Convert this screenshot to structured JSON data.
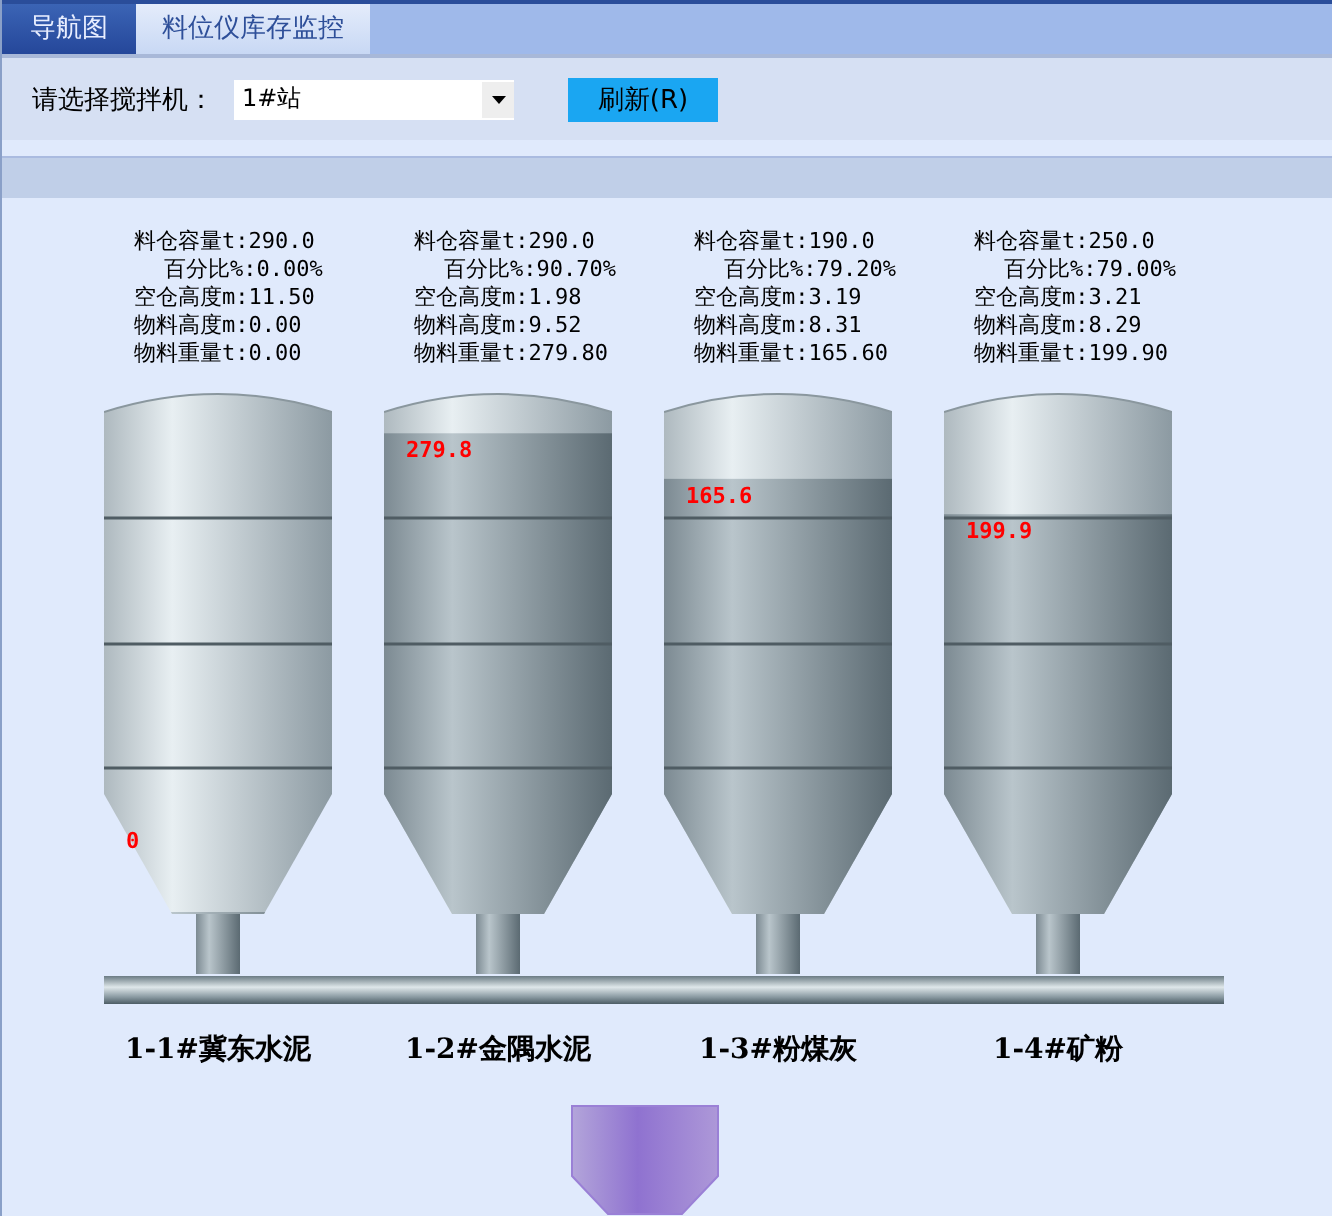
{
  "tabs": [
    {
      "label": "导航图",
      "selected": false
    },
    {
      "label": "料位仪库存监控",
      "selected": true
    }
  ],
  "toolbar": {
    "label": "请选择搅拌机：",
    "select_value": "1#站",
    "refresh_button": "刷新(R)"
  },
  "silos": [
    {
      "capacity": "料仓容量t:290.0",
      "percent": "百分比%:0.00%",
      "empty_height": "空仓高度m:11.50",
      "material_height": "物料高度m:0.00",
      "weight": "物料重量t:0.00",
      "level": 0,
      "fill_label": "0",
      "name": "1-1#冀东水泥"
    },
    {
      "capacity": "料仓容量t:290.0",
      "percent": "百分比%:90.70%",
      "empty_height": "空仓高度m:1.98",
      "material_height": "物料高度m:9.52",
      "weight": "物料重量t:279.80",
      "level": 0.95,
      "fill_label": "279.8",
      "name": "1-2#金隅水泥"
    },
    {
      "capacity": "料仓容量t:190.0",
      "percent": "百分比%:79.20%",
      "empty_height": "空仓高度m:3.19",
      "material_height": "物料高度m:8.31",
      "weight": "物料重量t:165.60",
      "level": 0.86,
      "fill_label": "165.6",
      "name": "1-3#粉煤灰"
    },
    {
      "capacity": "料仓容量t:250.0",
      "percent": "百分比%:79.00%",
      "empty_height": "空仓高度m:3.21",
      "material_height": "物料高度m:8.29",
      "weight": "物料重量t:199.90",
      "level": 0.79,
      "fill_label": "199.9",
      "name": "1-4#矿粉"
    }
  ]
}
